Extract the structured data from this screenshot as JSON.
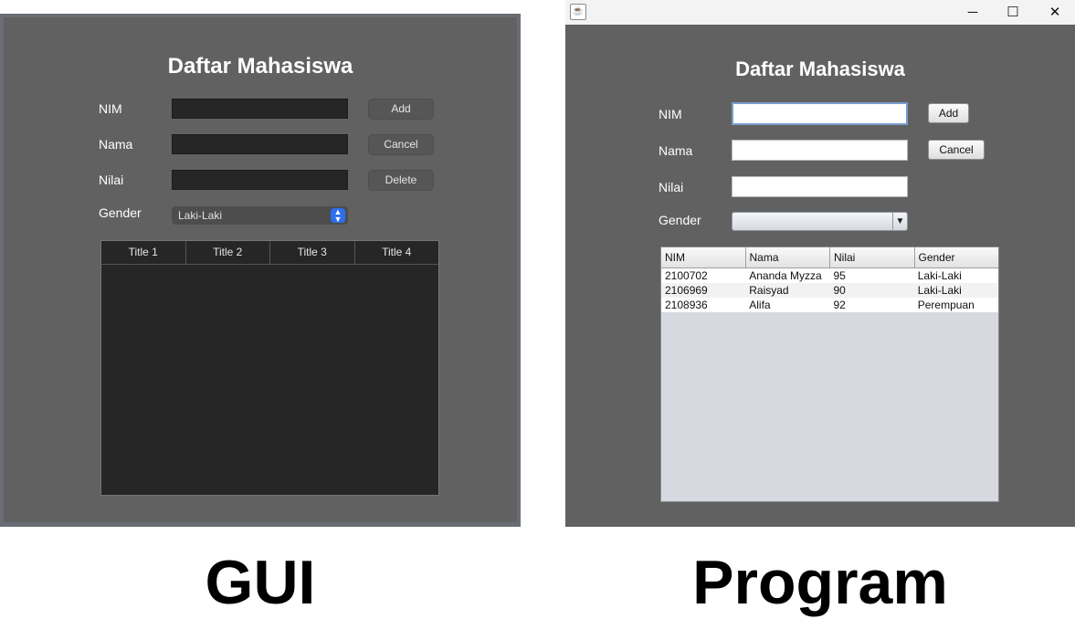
{
  "gui": {
    "title": "Daftar Mahasiswa",
    "labels": {
      "nim": "NIM",
      "nama": "Nama",
      "nilai": "Nilai",
      "gender": "Gender"
    },
    "buttons": {
      "add": "Add",
      "cancel": "Cancel",
      "delete": "Delete"
    },
    "gender_selected": "Laki-Laki",
    "table_headers": [
      "Title 1",
      "Title 2",
      "Title 3",
      "Title 4"
    ]
  },
  "program": {
    "title": "Daftar Mahasiswa",
    "labels": {
      "nim": "NIM",
      "nama": "Nama",
      "nilai": "Nilai",
      "gender": "Gender"
    },
    "buttons": {
      "add": "Add",
      "cancel": "Cancel"
    },
    "gender_selected": "",
    "window_controls": {
      "minimize": "─",
      "maximize": "☐",
      "close": "✕"
    },
    "table_headers": [
      "NIM",
      "Nama",
      "Nilai",
      "Gender"
    ],
    "rows": [
      [
        "2100702",
        "Ananda Myzza",
        "95",
        "Laki-Laki"
      ],
      [
        "2106969",
        "Raisyad",
        "90",
        "Laki-Laki"
      ],
      [
        "2108936",
        "Alifa",
        "92",
        "Perempuan"
      ]
    ]
  },
  "captions": {
    "left": "GUI",
    "right": "Program"
  }
}
